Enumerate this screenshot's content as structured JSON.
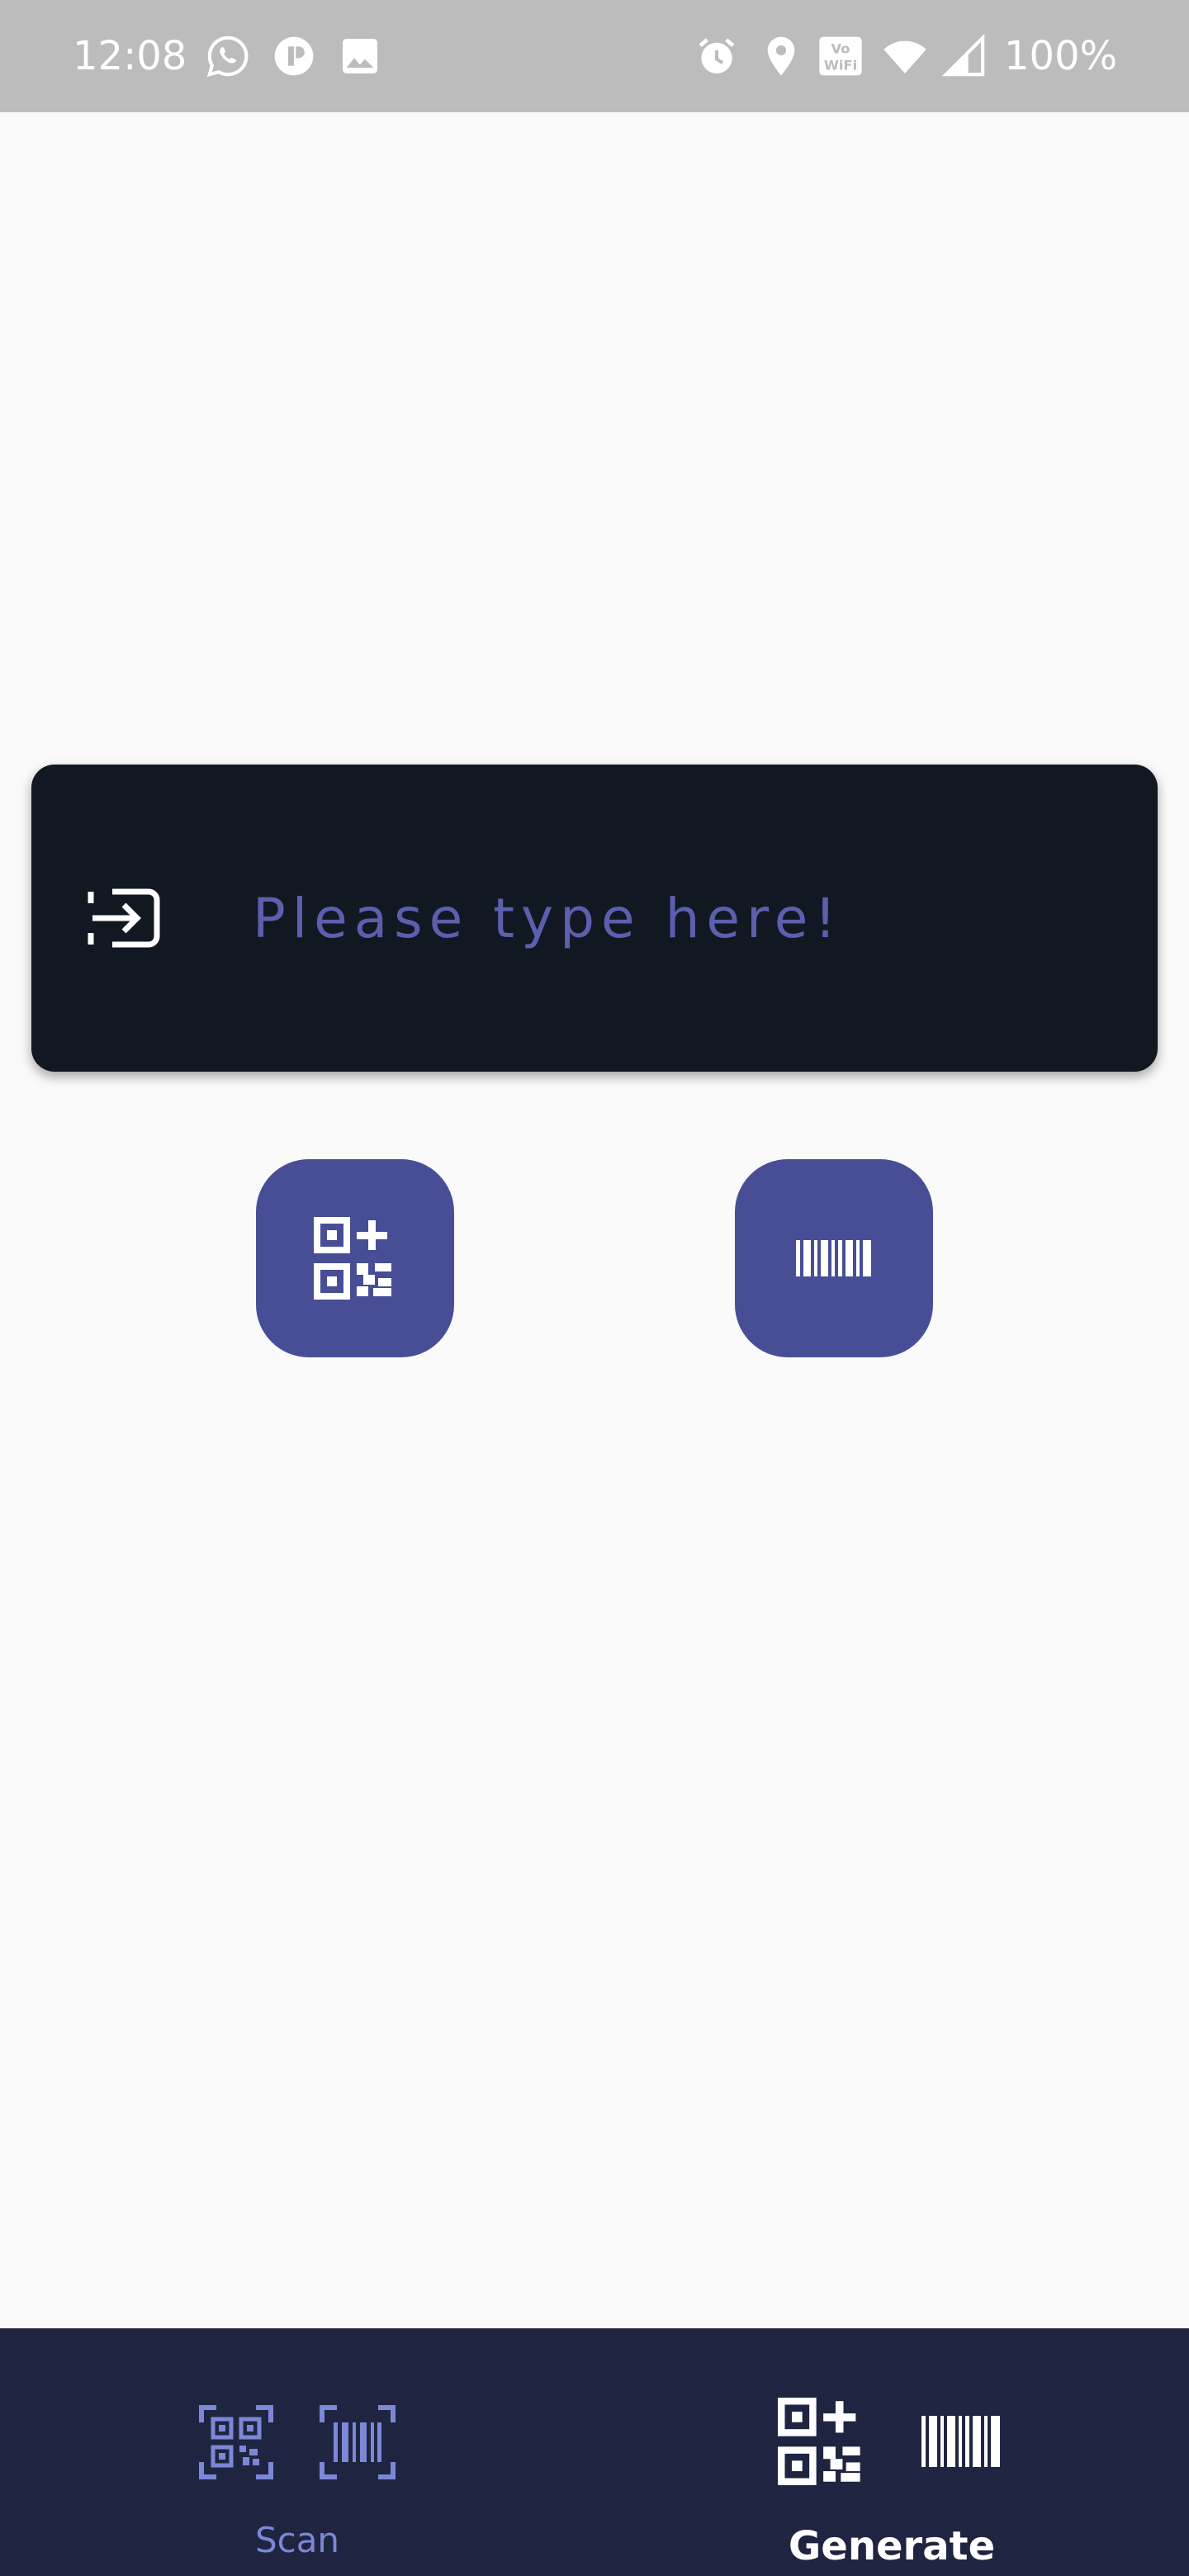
{
  "status_bar": {
    "time": "12:08",
    "battery": "100%",
    "left_icons": [
      "whatsapp-icon",
      "app-notification-icon",
      "image-icon"
    ],
    "right_icons": [
      "alarm-icon",
      "location-icon",
      "vowifi-icon",
      "wifi-icon",
      "signal-icon"
    ],
    "vowifi_text": "VoWiFi"
  },
  "input": {
    "placeholder": "Please type here!",
    "value": "",
    "icon": "input-icon"
  },
  "actions": {
    "qr_button": {
      "icon": "qr-code-add-icon"
    },
    "barcode_button": {
      "icon": "barcode-icon"
    }
  },
  "bottom_nav": {
    "items": [
      {
        "label": "Scan",
        "icons": [
          "qr-scan-icon",
          "barcode-scan-icon"
        ],
        "active": false
      },
      {
        "label": "Generate",
        "icons": [
          "qr-code-add-icon",
          "barcode-icon"
        ],
        "active": true
      }
    ]
  },
  "colors": {
    "status_bar": "#bcbcbc",
    "background": "#fafafa",
    "card": "#111822",
    "placeholder": "#5b5fae",
    "button": "#474e96",
    "nav_background": "#1f2540",
    "nav_inactive": "#7d87d8",
    "nav_active": "#ffffff"
  }
}
